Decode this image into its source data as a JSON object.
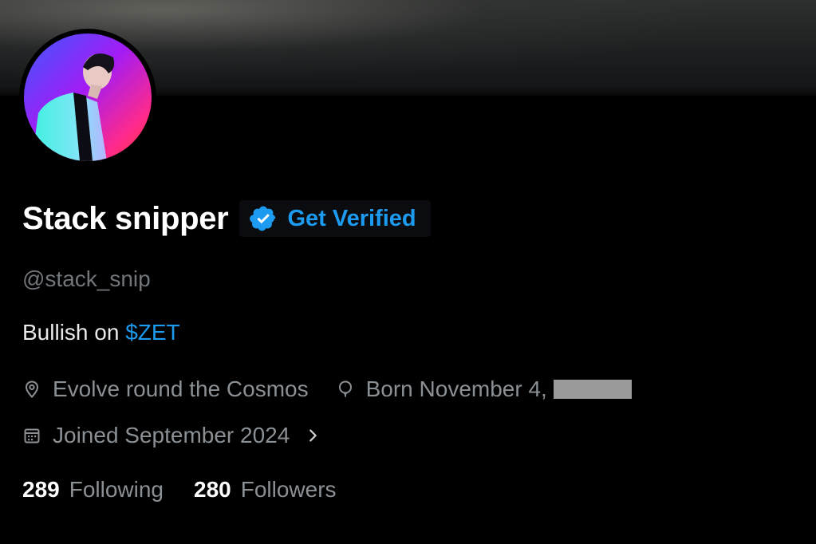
{
  "profile": {
    "display_name": "Stack snipper",
    "verify_label": "Get Verified",
    "handle": "@stack_snip",
    "bio_prefix": "Bullish on ",
    "bio_cashtag": "$ZET",
    "location": "Evolve round the Cosmos",
    "birth": "Born November 4,",
    "joined": "Joined September 2024",
    "following_count": "289",
    "following_label": "Following",
    "followers_count": "280",
    "followers_label": "Followers"
  },
  "icons": {
    "verified": "verified-badge-icon",
    "location": "location-pin-icon",
    "birthday": "balloon-icon",
    "calendar": "calendar-icon",
    "chevron": "chevron-right-icon"
  },
  "colors": {
    "accent": "#1d9bf0",
    "background": "#000000",
    "primary_text": "#e7e9ea",
    "secondary_text": "#71767b"
  }
}
